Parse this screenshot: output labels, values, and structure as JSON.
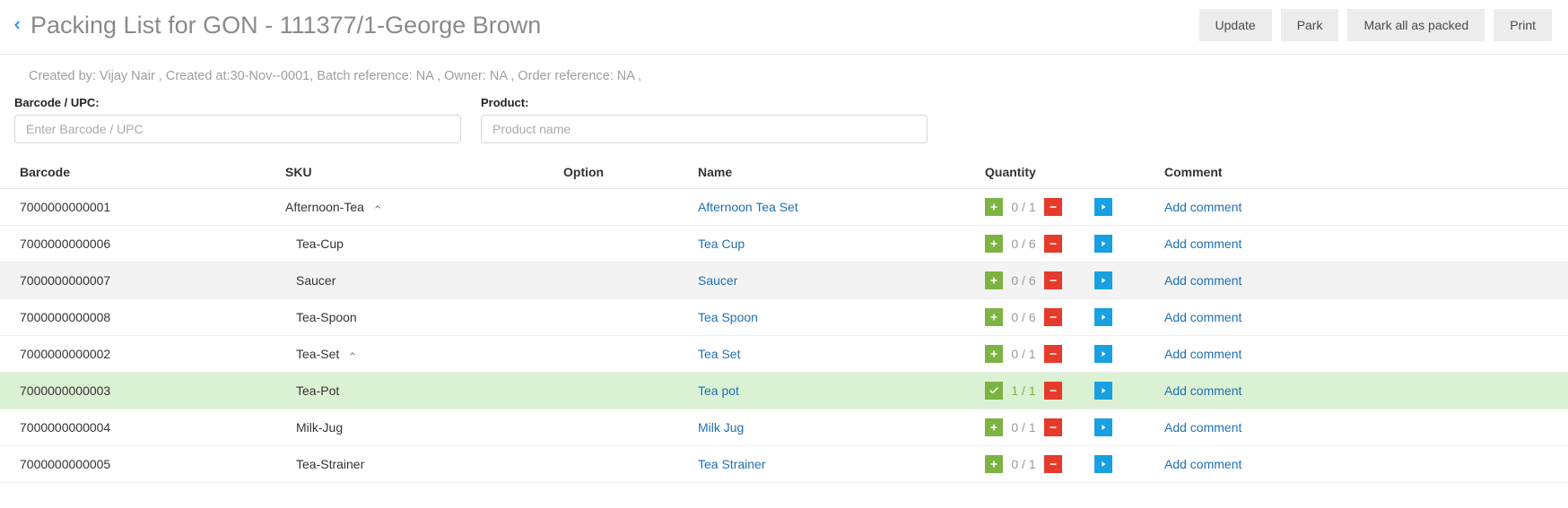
{
  "header": {
    "title": "Packing List for GON - 111377/1-George Brown",
    "actions": {
      "update": "Update",
      "park": "Park",
      "mark_all": "Mark all as packed",
      "print": "Print"
    }
  },
  "meta": "Created by: Vijay Nair , Created at:30-Nov--0001, Batch reference: NA , Owner: NA , Order reference: NA ,",
  "filters": {
    "barcode_label": "Barcode / UPC:",
    "barcode_placeholder": "Enter Barcode / UPC",
    "product_label": "Product:",
    "product_placeholder": "Product name"
  },
  "columns": {
    "barcode": "Barcode",
    "sku": "SKU",
    "option": "Option",
    "name": "Name",
    "quantity": "Quantity",
    "comment": "Comment"
  },
  "add_comment_label": "Add comment",
  "rows": [
    {
      "barcode": "7000000000001",
      "sku": "Afternoon-Tea",
      "expandable": true,
      "indent": false,
      "name": "Afternoon Tea Set",
      "packed": 0,
      "total": 1,
      "done": false,
      "striped": false
    },
    {
      "barcode": "7000000000006",
      "sku": "Tea-Cup",
      "expandable": false,
      "indent": true,
      "name": "Tea Cup",
      "packed": 0,
      "total": 6,
      "done": false,
      "striped": false
    },
    {
      "barcode": "7000000000007",
      "sku": "Saucer",
      "expandable": false,
      "indent": true,
      "name": "Saucer",
      "packed": 0,
      "total": 6,
      "done": false,
      "striped": true
    },
    {
      "barcode": "7000000000008",
      "sku": "Tea-Spoon",
      "expandable": false,
      "indent": true,
      "name": "Tea Spoon",
      "packed": 0,
      "total": 6,
      "done": false,
      "striped": false
    },
    {
      "barcode": "7000000000002",
      "sku": "Tea-Set",
      "expandable": true,
      "indent": true,
      "name": "Tea Set",
      "packed": 0,
      "total": 1,
      "done": false,
      "striped": false
    },
    {
      "barcode": "7000000000003",
      "sku": "Tea-Pot",
      "expandable": false,
      "indent": true,
      "name": "Tea pot",
      "packed": 1,
      "total": 1,
      "done": true,
      "striped": false
    },
    {
      "barcode": "7000000000004",
      "sku": "Milk-Jug",
      "expandable": false,
      "indent": true,
      "name": "Milk Jug",
      "packed": 0,
      "total": 1,
      "done": false,
      "striped": false
    },
    {
      "barcode": "7000000000005",
      "sku": "Tea-Strainer",
      "expandable": false,
      "indent": true,
      "name": "Tea Strainer",
      "packed": 0,
      "total": 1,
      "done": false,
      "striped": false
    }
  ]
}
